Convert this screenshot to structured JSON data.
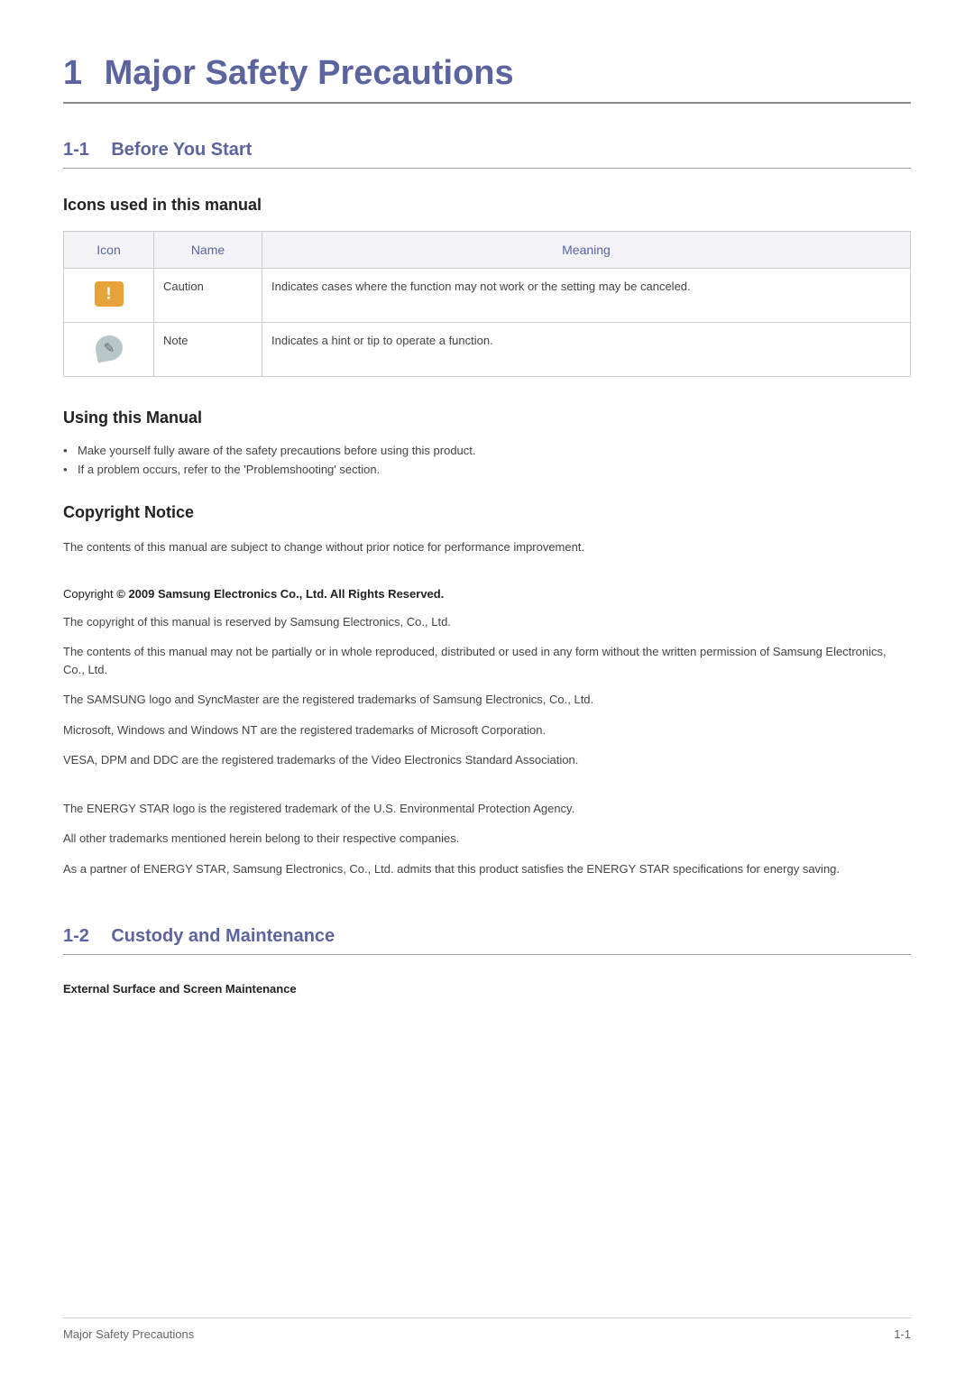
{
  "chapter": {
    "num": "1",
    "title": "Major Safety Precautions"
  },
  "section_1_1": {
    "num": "1-1",
    "title": "Before You Start"
  },
  "icons_heading": "Icons used in this manual",
  "table": {
    "headers": {
      "icon": "Icon",
      "name": "Name",
      "meaning": "Meaning"
    },
    "rows": [
      {
        "name": "Caution",
        "meaning": "Indicates cases where the function may not work or the setting may be canceled."
      },
      {
        "name": "Note",
        "meaning": "Indicates a hint or tip to operate a function."
      }
    ]
  },
  "using_manual": {
    "heading": "Using this Manual",
    "items": [
      "Make yourself fully aware of the safety precautions before using this product.",
      "If a problem occurs, refer to the 'Problemshooting' section."
    ]
  },
  "copyright": {
    "heading": "Copyright Notice",
    "p1": "The contents of this manual are subject to change without prior notice for performance improvement.",
    "line_prefix": "Copyright ",
    "line_bold": "© 2009 Samsung Electronics Co., Ltd. All Rights Reserved.",
    "p2": "The copyright of this manual is reserved by Samsung Electronics, Co., Ltd.",
    "p3": "The contents of this manual may not be partially or in whole reproduced, distributed or used in any form without the written permission of Samsung Electronics, Co., Ltd.",
    "p4": "The SAMSUNG logo and SyncMaster are the registered trademarks of Samsung Electronics, Co., Ltd.",
    "p5": "Microsoft, Windows and Windows NT are the registered trademarks of Microsoft Corporation.",
    "p6": "VESA, DPM and DDC are the registered trademarks of the Video Electronics Standard Association.",
    "p7": "The ENERGY STAR logo is the registered trademark of the U.S. Environmental Protection Agency.",
    "p8": "All other trademarks mentioned herein belong to their respective companies.",
    "p9": "As a partner of ENERGY STAR, Samsung Electronics, Co., Ltd. admits that this product satisfies the ENERGY STAR specifications for energy saving."
  },
  "section_1_2": {
    "num": "1-2",
    "title": "Custody and Maintenance"
  },
  "external_surface": "External Surface and Screen Maintenance",
  "footer": {
    "left": "Major Safety Precautions",
    "right": "1-1"
  }
}
